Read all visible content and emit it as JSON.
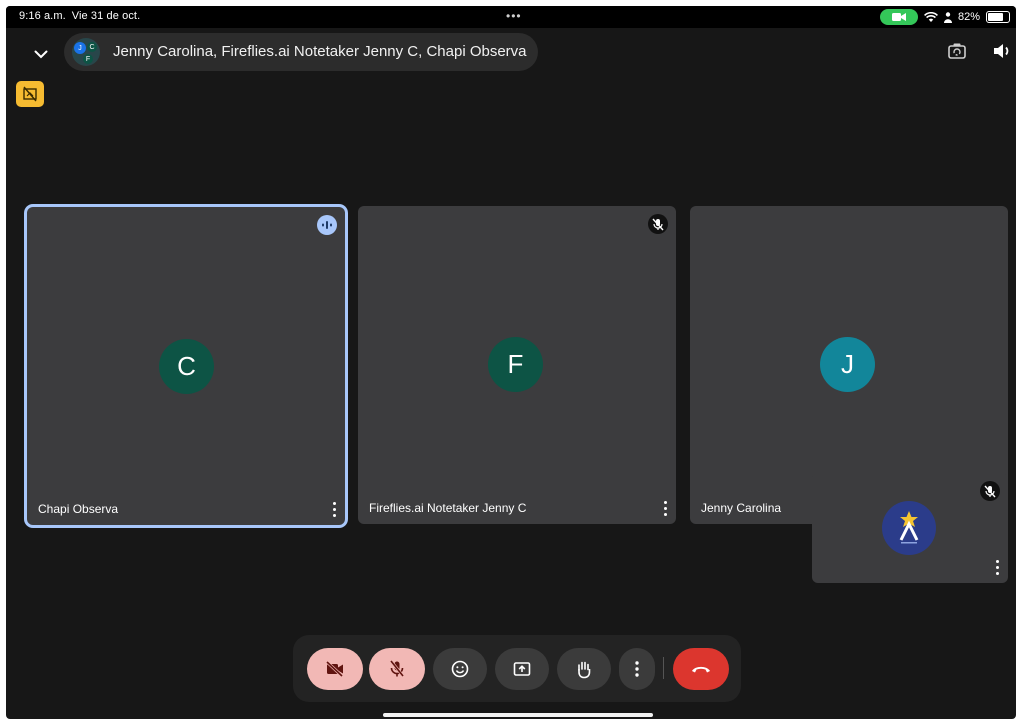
{
  "status_bar": {
    "time": "9:16 a.m.",
    "date": "Vie 31 de oct.",
    "dots": "•••",
    "battery_text": "82%",
    "battery_level": 0.82
  },
  "meeting": {
    "title": "Jenny Carolina, Fireflies.ai Notetaker Jenny C, Chapi Observa",
    "avatar_cluster": [
      "J",
      "C",
      "F"
    ]
  },
  "participants": [
    {
      "name": "Chapi Observa",
      "initial": "C",
      "avatar_color": "#0d5445",
      "speaking": true,
      "muted": false
    },
    {
      "name": "Fireflies.ai Notetaker Jenny C",
      "initial": "F",
      "avatar_color": "#0d5445",
      "speaking": false,
      "muted": true
    },
    {
      "name": "Jenny Carolina",
      "initial": "J",
      "avatar_color": "#12869a",
      "speaking": false,
      "muted": false
    }
  ],
  "self_view": {
    "muted": true,
    "camera_off": true
  },
  "controls": [
    {
      "id": "camera",
      "icon": "video-off-icon",
      "state": "off",
      "color": "#f2b8b5"
    },
    {
      "id": "mic",
      "icon": "mic-off-icon",
      "state": "off",
      "color": "#f2b8b5"
    },
    {
      "id": "reactions",
      "icon": "smiley-icon"
    },
    {
      "id": "present",
      "icon": "present-screen-icon"
    },
    {
      "id": "raise-hand",
      "icon": "hand-icon"
    },
    {
      "id": "more",
      "icon": "more-vertical-icon"
    },
    {
      "id": "leave",
      "icon": "end-call-icon",
      "color": "#dc362e"
    }
  ],
  "colors": {
    "background": "#171717",
    "tile": "#3c3c3e",
    "active_border": "#a8c7fa",
    "warning_badge": "#f6bb31",
    "camera_indicator": "#34c759"
  }
}
